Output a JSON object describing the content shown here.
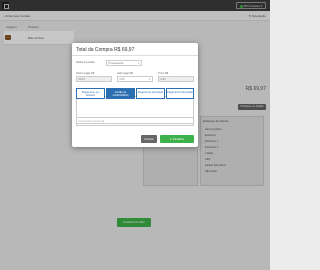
{
  "app": {
    "user_menu": "PDV Usuário",
    "back_link": "Voltar para Vendas",
    "devolucao_link": "Devolução",
    "table_header_image": "Imagem",
    "table_header_product": "Produto",
    "product_name": "Bolo de Pote",
    "total_label": "R$ 69,97",
    "plus_button": "Produtos em Adição",
    "client_panel_title": "Endereço do Cliente",
    "client_lines": [
      "Santo Pg Rios",
      "Endereço",
      "Endereço 1",
      "Endereço 2",
      "Cidade",
      "CEP",
      "Estado São Paulo",
      "São Paulo"
    ],
    "ship_lines": [
      "Endereço 2",
      "Cidade",
      "CEP",
      "Estado São Paulo",
      "São Paulo"
    ],
    "bottom_finish": "Finalizar Pedido"
  },
  "modal": {
    "title": "Total da Compra R$ 69,97",
    "status_label": "Status do pedido",
    "status_value": "Processando",
    "total_pay_label": "Total a pagar R$",
    "total_pay_value": "69,97",
    "paid_label": "Valor pago R$",
    "paid_value": "0,00",
    "change_label": "Troco R$",
    "change_value": "0,00",
    "payment_method_label": "Método de pagamento",
    "payment_tabs": [
      "Pagamento em dinheiro",
      "Cartão de crédito/Débito",
      "Pagamento parcelado",
      "Pagamento Parcelado"
    ],
    "active_tab_index": 1,
    "obs_placeholder": "Comentários (opcional)",
    "cancel_button": "Fechar",
    "finish_button": "Finalizar"
  },
  "colors": {
    "accent_blue": "#2b6fb2",
    "success_green": "#3eb24a",
    "topbar": "#3d3d3d"
  }
}
